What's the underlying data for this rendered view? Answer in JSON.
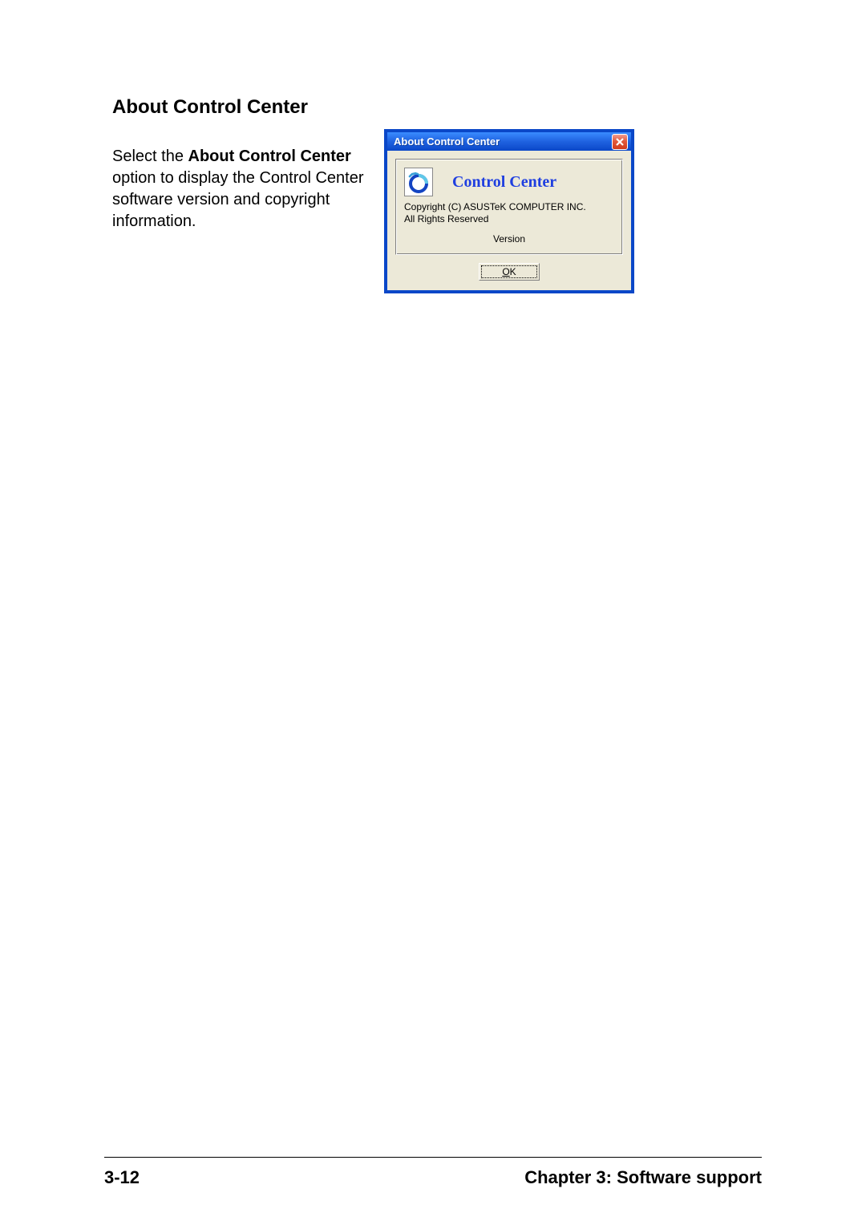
{
  "heading": "About Control Center",
  "description": {
    "prefix": "Select the ",
    "bold": "About Control Center",
    "rest": " option to display the Control Center software version and copyright information."
  },
  "dialog": {
    "title": "About Control Center",
    "close_icon_name": "close-icon",
    "product_name": "Control Center",
    "copyright_line1": "Copyright (C) ASUSTeK COMPUTER INC.",
    "copyright_line2": "All Rights Reserved",
    "version_label": "Version",
    "ok_prefix": "O",
    "ok_suffix": "K"
  },
  "footer": {
    "page_number": "3-12",
    "chapter": "Chapter 3: Software support"
  }
}
